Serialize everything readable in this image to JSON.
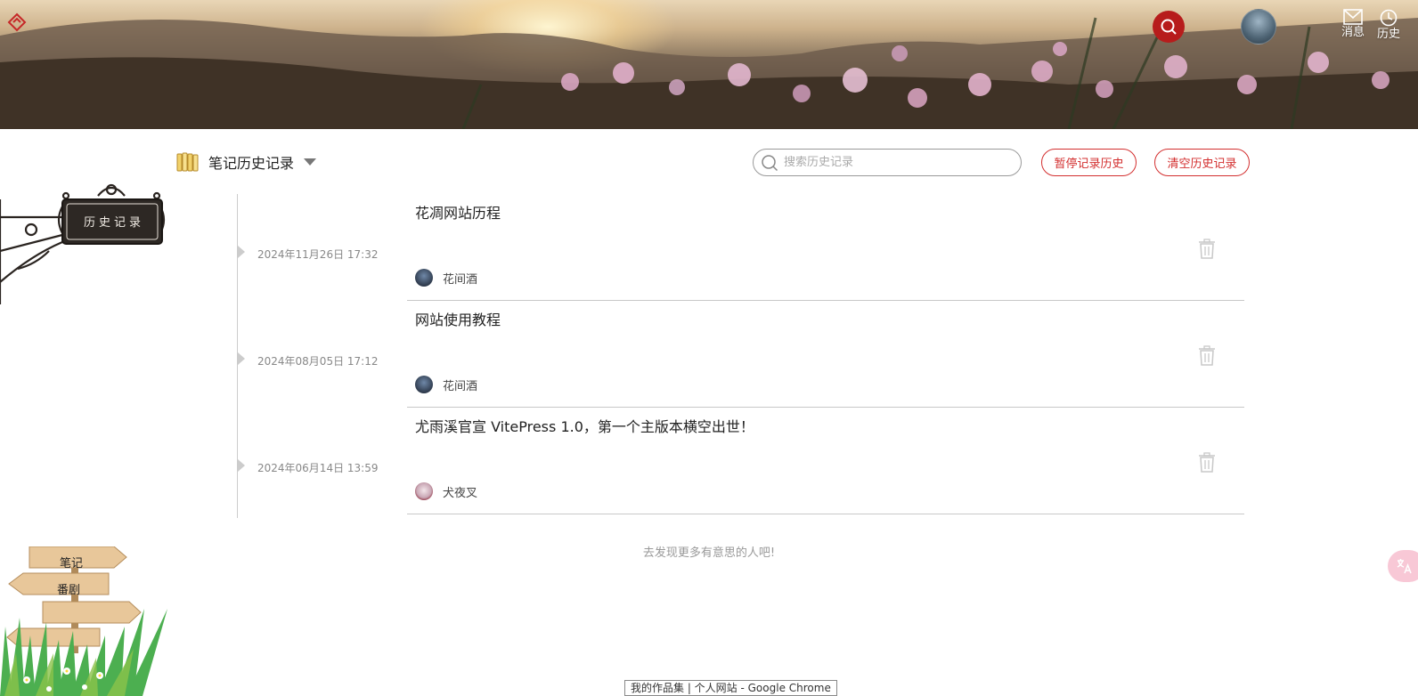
{
  "header": {
    "messages_label": "消息",
    "history_label": "历史"
  },
  "toolbar": {
    "title": "笔记历史记录",
    "search_placeholder": "搜索历史记录",
    "pause_button": "暂停记录历史",
    "clear_button": "清空历史记录"
  },
  "signboard": {
    "text": "历史记录"
  },
  "entries": [
    {
      "title": "花凋网站历程",
      "date": "2024年11月26日 17:32",
      "author": "花间酒",
      "avatar_color": "#3b4a5e"
    },
    {
      "title": "网站使用教程",
      "date": "2024年08月05日 17:12",
      "author": "花间酒",
      "avatar_color": "#3b4a5e"
    },
    {
      "title": "尤雨溪官宣 VitePress 1.0，第一个主版本横空出世！",
      "date": "2024年06月14日 13:59",
      "author": "犬夜叉",
      "avatar_color": "#c9a7b5"
    }
  ],
  "footer": {
    "more_text": "去发现更多有意思的人吧!"
  },
  "side_signs": {
    "sign1": "笔记",
    "sign2": "番剧"
  },
  "tooltip": "我的作品集 | 个人网站 - Google Chrome",
  "colors": {
    "accent_red": "#d32f2f",
    "search_circle": "#b71c1c"
  }
}
